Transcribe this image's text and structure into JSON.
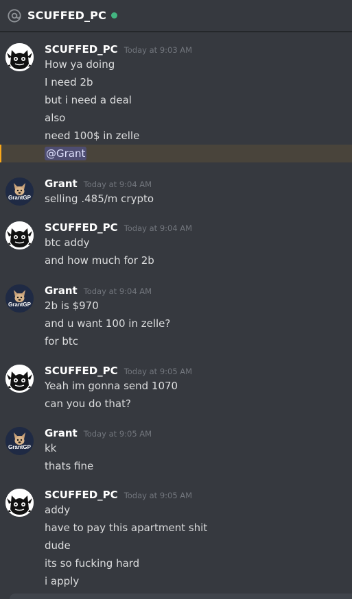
{
  "header": {
    "channel_name": "SCUFFED_PC",
    "status": "online",
    "status_color": "#43b581"
  },
  "icons": {
    "header_icon": "at-sign-icon",
    "scuffed_avatar": "cat-avatar-icon",
    "grant_avatar": "dog-avatar-icon"
  },
  "grant_avatar_text": "GrantGP",
  "messages": [
    {
      "author": "SCUFFED_PC",
      "time": "Today at 9:03 AM",
      "lines": [
        "How ya doing",
        "I need 2b",
        "but i need a deal",
        "also",
        "need 100$ in zelle"
      ],
      "mention": "@Grant"
    },
    {
      "author": "Grant",
      "time": "Today at 9:04 AM",
      "lines": [
        "selling .485/m crypto"
      ]
    },
    {
      "author": "SCUFFED_PC",
      "time": "Today at 9:04 AM",
      "lines": [
        "btc addy",
        "and how much for 2b"
      ]
    },
    {
      "author": "Grant",
      "time": "Today at 9:04 AM",
      "lines": [
        "2b is $970",
        "and u want 100 in zelle?",
        "for btc"
      ]
    },
    {
      "author": "SCUFFED_PC",
      "time": "Today at 9:05 AM",
      "lines": [
        "Yeah im gonna send 1070",
        "can you do that?"
      ]
    },
    {
      "author": "Grant",
      "time": "Today at 9:05 AM",
      "lines": [
        "kk",
        "thats fine"
      ]
    },
    {
      "author": "SCUFFED_PC",
      "time": "Today at 9:05 AM",
      "lines": [
        "addy",
        "have to pay this apartment shit",
        "dude",
        "its so fucking hard",
        "i apply"
      ]
    }
  ]
}
